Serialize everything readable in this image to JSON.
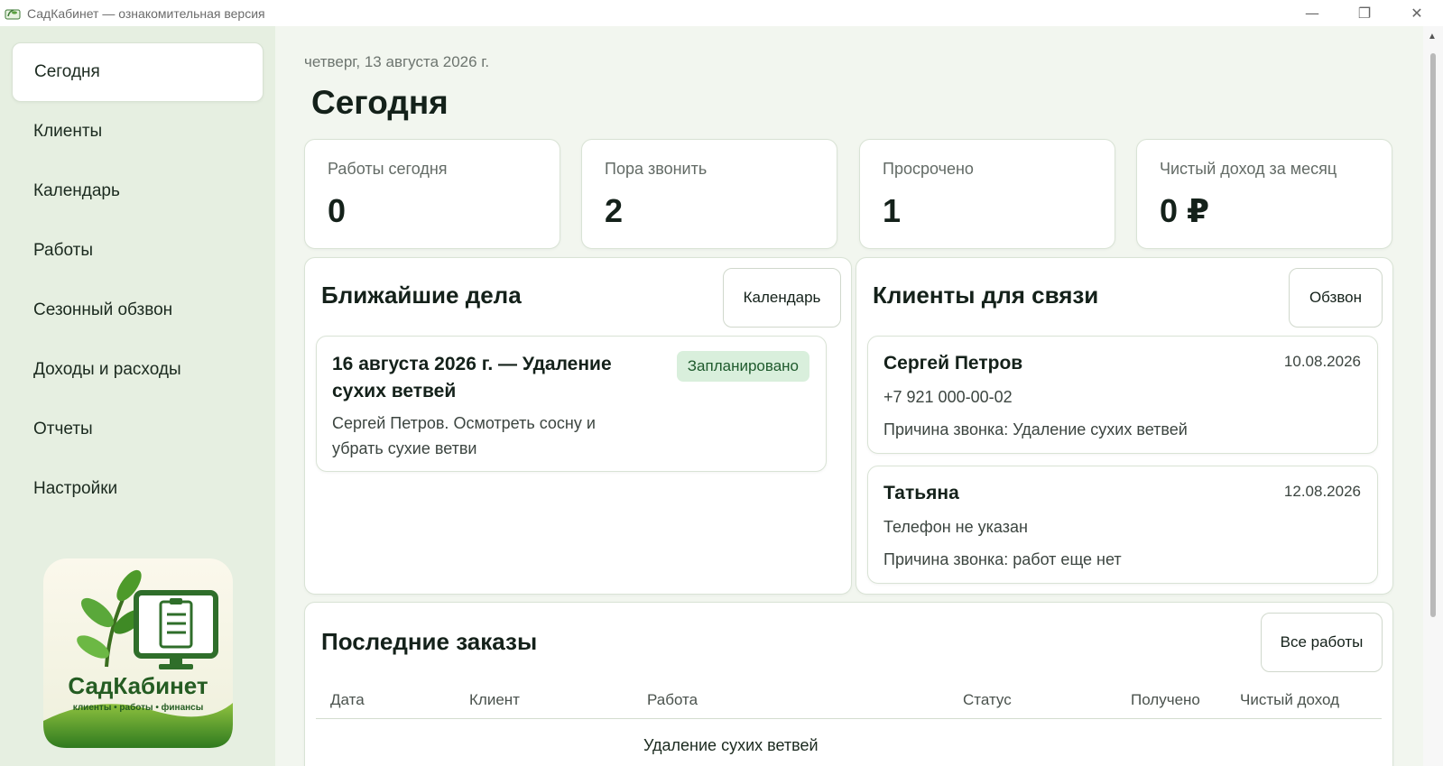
{
  "window": {
    "title": "СадКабинет — ознакомительная версия",
    "minimize_icon": "minimize-icon",
    "maximize_icon": "restore-icon",
    "close_icon": "close-icon"
  },
  "sidebar": {
    "items": [
      {
        "label": "Сегодня",
        "active": true
      },
      {
        "label": "Клиенты"
      },
      {
        "label": "Календарь"
      },
      {
        "label": "Работы"
      },
      {
        "label": "Сезонный обзвон"
      },
      {
        "label": "Доходы и расходы"
      },
      {
        "label": "Отчеты"
      },
      {
        "label": "Настройки"
      }
    ],
    "logo": {
      "name": "СадКабинет",
      "tagline": "клиенты • работы • финансы"
    }
  },
  "header": {
    "date": "четверг, 13 августа 2026 г.",
    "title": "Сегодня"
  },
  "stats": [
    {
      "label": "Работы сегодня",
      "value": "0"
    },
    {
      "label": "Пора звонить",
      "value": "2"
    },
    {
      "label": "Просрочено",
      "value": "1"
    },
    {
      "label": "Чистый доход за месяц",
      "value": "0 ₽"
    }
  ],
  "upcoming": {
    "title": "Ближайшие дела",
    "button": "Календарь",
    "items": [
      {
        "title": "16 августа 2026 г. — Удаление сухих ветвей",
        "description": "Сергей Петров. Осмотреть сосну и убрать сухие ветви",
        "status": "Запланировано"
      }
    ]
  },
  "contacts": {
    "title": "Клиенты для связи",
    "button": "Обзвон",
    "items": [
      {
        "name": "Сергей Петров",
        "date": "10.08.2026",
        "phone": "+7 921 000-00-02",
        "reason": "Причина звонка: Удаление сухих ветвей"
      },
      {
        "name": "Татьяна",
        "date": "12.08.2026",
        "phone": "Телефон не указан",
        "reason": "Причина звонка: работ еще нет"
      }
    ]
  },
  "orders": {
    "title": "Последние заказы",
    "button": "Все работы",
    "columns": [
      "Дата",
      "Клиент",
      "Работа",
      "Статус",
      "Получено",
      "Чистый доход"
    ],
    "rows": [
      {
        "work": "Удаление сухих ветвей"
      }
    ]
  },
  "colors": {
    "accent_green": "#2e7d32",
    "badge_bg": "#d9efdc",
    "sidebar_bg": "#e6efe1",
    "main_bg": "#f2f6ef"
  }
}
